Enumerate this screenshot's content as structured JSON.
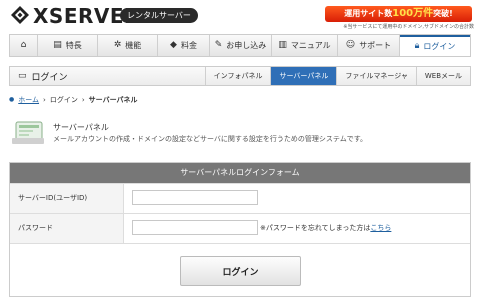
{
  "header": {
    "logo_text": "XSERVER",
    "rental_label": "レンタルサーバー",
    "promo_prefix": "運用サイト数",
    "promo_number": "100万件",
    "promo_suffix": "突破!",
    "promo_note": "※当サービスにて運用中のドメイン,サブドメインの合計数"
  },
  "nav": {
    "items": [
      {
        "label": "",
        "icon": "home-icon"
      },
      {
        "label": "特長",
        "icon": "list-icon"
      },
      {
        "label": "機能",
        "icon": "gear-icon"
      },
      {
        "label": "料金",
        "icon": "tag-icon"
      },
      {
        "label": "お申し込み",
        "icon": "pencil-icon"
      },
      {
        "label": "マニュアル",
        "icon": "book-icon"
      },
      {
        "label": "サポート",
        "icon": "person-icon"
      },
      {
        "label": "ログイン",
        "icon": "lock-icon"
      }
    ]
  },
  "subheader": {
    "title": "ログイン",
    "tabs": [
      "インフォパネル",
      "サーバーパネル",
      "ファイルマネージャ",
      "WEBメール"
    ]
  },
  "breadcrumb": {
    "items": [
      "ホーム",
      "ログイン",
      "サーバーパネル"
    ]
  },
  "intro": {
    "title": "サーバーパネル",
    "description": "メールアカウントの作成・ドメインの設定などサーバに関する設定を行うための管理システムです。"
  },
  "form": {
    "heading": "サーバーパネルログインフォーム",
    "id_label": "サーバーID(ユーザID)",
    "password_label": "パスワード",
    "forgot_text": "※パスワードを忘れてしまった方は",
    "forgot_link": "こちら",
    "login_button": "ログイン"
  },
  "colors": {
    "accent": "#2f6fb7",
    "promo": "#e0300f",
    "form_header": "#777777"
  }
}
